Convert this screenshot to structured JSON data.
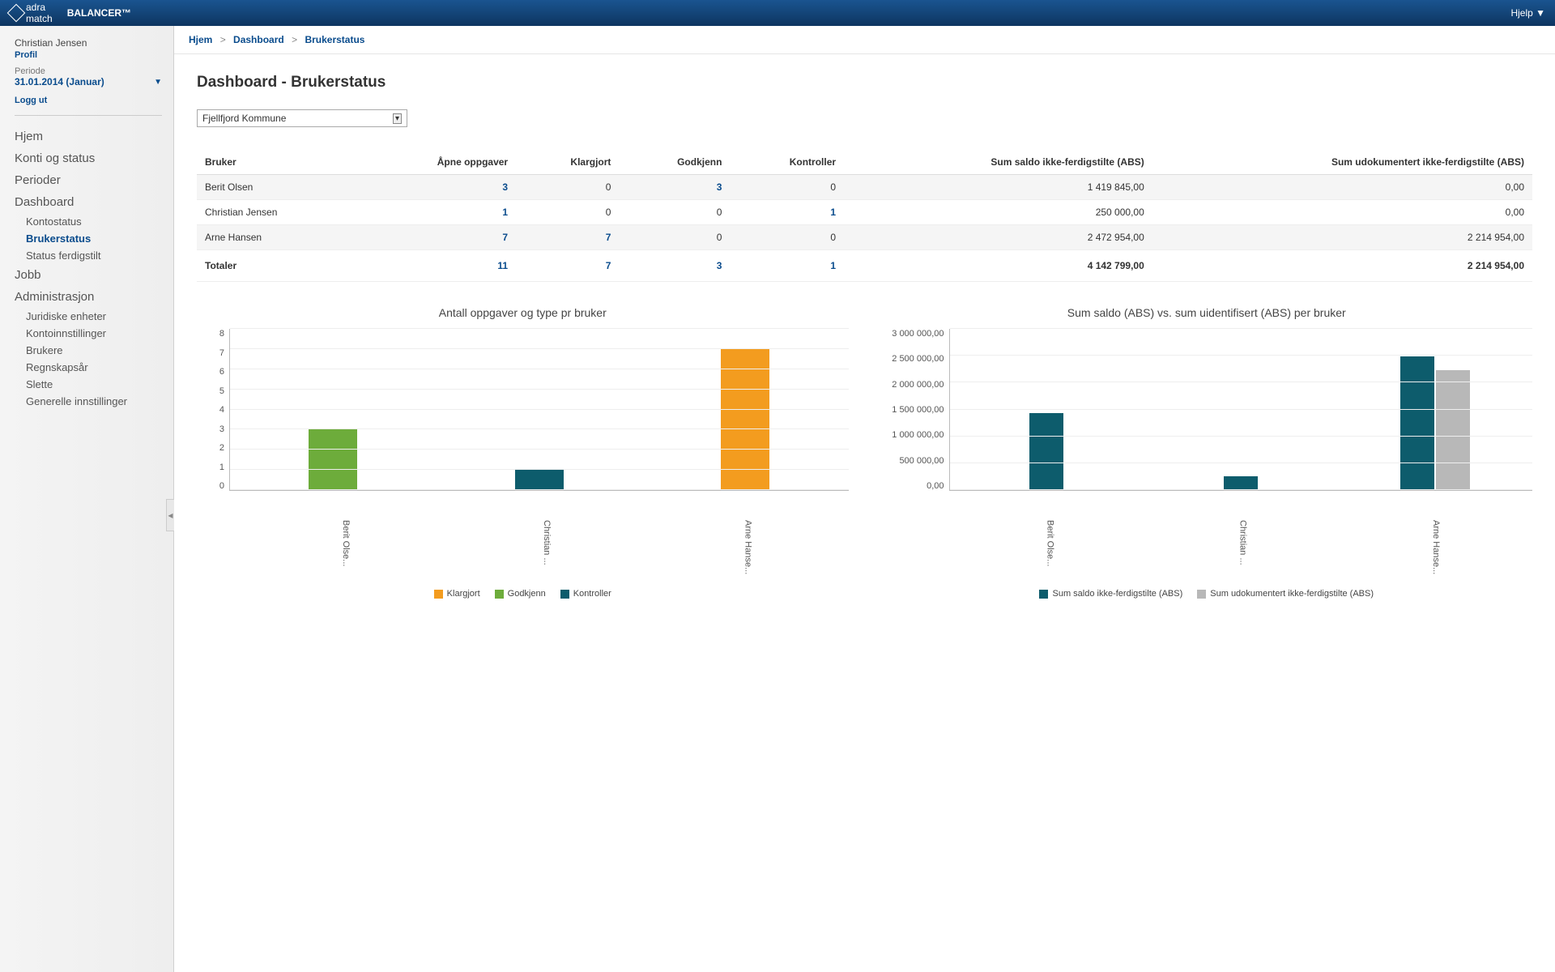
{
  "topbar": {
    "logo_text_top": "adra",
    "logo_text_bottom": "match",
    "app_name": "BALANCER™",
    "help": "Hjelp ▼"
  },
  "sidebar": {
    "user_name": "Christian Jensen",
    "profile": "Profil",
    "period_label": "Periode",
    "period_value": "31.01.2014 (Januar)",
    "logout": "Logg ut",
    "nav": [
      {
        "label": "Hjem"
      },
      {
        "label": "Konti og status"
      },
      {
        "label": "Perioder"
      },
      {
        "label": "Dashboard",
        "children": [
          {
            "label": "Kontostatus"
          },
          {
            "label": "Brukerstatus",
            "active": true
          },
          {
            "label": "Status ferdigstilt"
          }
        ]
      },
      {
        "label": "Jobb"
      },
      {
        "label": "Administrasjon",
        "children": [
          {
            "label": "Juridiske enheter"
          },
          {
            "label": "Kontoinnstillinger"
          },
          {
            "label": "Brukere"
          },
          {
            "label": "Regnskapsår"
          },
          {
            "label": "Slette"
          },
          {
            "label": "Generelle innstillinger"
          }
        ]
      }
    ]
  },
  "breadcrumb": {
    "items": [
      "Hjem",
      "Dashboard",
      "Brukerstatus"
    ],
    "sep": ">"
  },
  "page_title": "Dashboard - Brukerstatus",
  "entity_select": "Fjellfjord Kommune",
  "table": {
    "headers": [
      "Bruker",
      "Åpne oppgaver",
      "Klargjort",
      "Godkjenn",
      "Kontroller",
      "Sum saldo ikke-ferdigstilte (ABS)",
      "Sum udokumentert ikke-ferdigstilte (ABS)"
    ],
    "rows": [
      {
        "bruker": "Berit Olsen",
        "apne": "3",
        "klargjort": "0",
        "godkjenn": "3",
        "kontroller": "0",
        "saldo": "1 419 845,00",
        "udok": "0,00"
      },
      {
        "bruker": "Christian Jensen",
        "apne": "1",
        "klargjort": "0",
        "godkjenn": "0",
        "kontroller": "1",
        "saldo": "250 000,00",
        "udok": "0,00"
      },
      {
        "bruker": "Arne Hansen",
        "apne": "7",
        "klargjort": "7",
        "godkjenn": "0",
        "kontroller": "0",
        "saldo": "2 472 954,00",
        "udok": "2 214 954,00"
      }
    ],
    "totals": {
      "label": "Totaler",
      "apne": "11",
      "klargjort": "7",
      "godkjenn": "3",
      "kontroller": "1",
      "saldo": "4 142 799,00",
      "udok": "2 214 954,00"
    }
  },
  "chart1": {
    "title": "Antall oppgaver og type pr bruker",
    "y_ticks": [
      "8",
      "7",
      "6",
      "5",
      "4",
      "3",
      "2",
      "1",
      "0"
    ],
    "x_labels": [
      "Berit Olse...",
      "Christian ...",
      "Arne Hanse..."
    ],
    "legend": [
      "Klargjort",
      "Godkjenn",
      "Kontroller"
    ]
  },
  "chart2": {
    "title": "Sum saldo (ABS) vs. sum uidentifisert (ABS) per bruker",
    "y_ticks": [
      "3 000 000,00",
      "2 500 000,00",
      "2 000 000,00",
      "1 500 000,00",
      "1 000 000,00",
      "500 000,00",
      "0,00"
    ],
    "x_labels": [
      "Berit Olse...",
      "Christian ...",
      "Arne Hanse..."
    ],
    "legend": [
      "Sum saldo ikke-ferdigstilte (ABS)",
      "Sum udokumentert ikke-ferdigstilte (ABS)"
    ]
  },
  "chart_data": [
    {
      "type": "bar",
      "title": "Antall oppgaver og type pr bruker",
      "categories": [
        "Berit Olsen",
        "Christian Jensen",
        "Arne Hansen"
      ],
      "series": [
        {
          "name": "Klargjort",
          "values": [
            0,
            0,
            7
          ],
          "color": "#f39c1f"
        },
        {
          "name": "Godkjenn",
          "values": [
            3,
            0,
            0
          ],
          "color": "#6dac3b"
        },
        {
          "name": "Kontroller",
          "values": [
            0,
            1,
            0
          ],
          "color": "#0d5c6c"
        }
      ],
      "ylabel": "",
      "xlabel": "",
      "ylim": [
        0,
        8
      ]
    },
    {
      "type": "bar",
      "title": "Sum saldo (ABS) vs. sum uidentifisert (ABS) per bruker",
      "categories": [
        "Berit Olsen",
        "Christian Jensen",
        "Arne Hansen"
      ],
      "series": [
        {
          "name": "Sum saldo ikke-ferdigstilte (ABS)",
          "values": [
            1419845,
            250000,
            2472954
          ],
          "color": "#0d5c6c"
        },
        {
          "name": "Sum udokumentert ikke-ferdigstilte (ABS)",
          "values": [
            0,
            0,
            2214954
          ],
          "color": "#b8b8b8"
        }
      ],
      "ylabel": "",
      "xlabel": "",
      "ylim": [
        0,
        3000000
      ]
    }
  ]
}
